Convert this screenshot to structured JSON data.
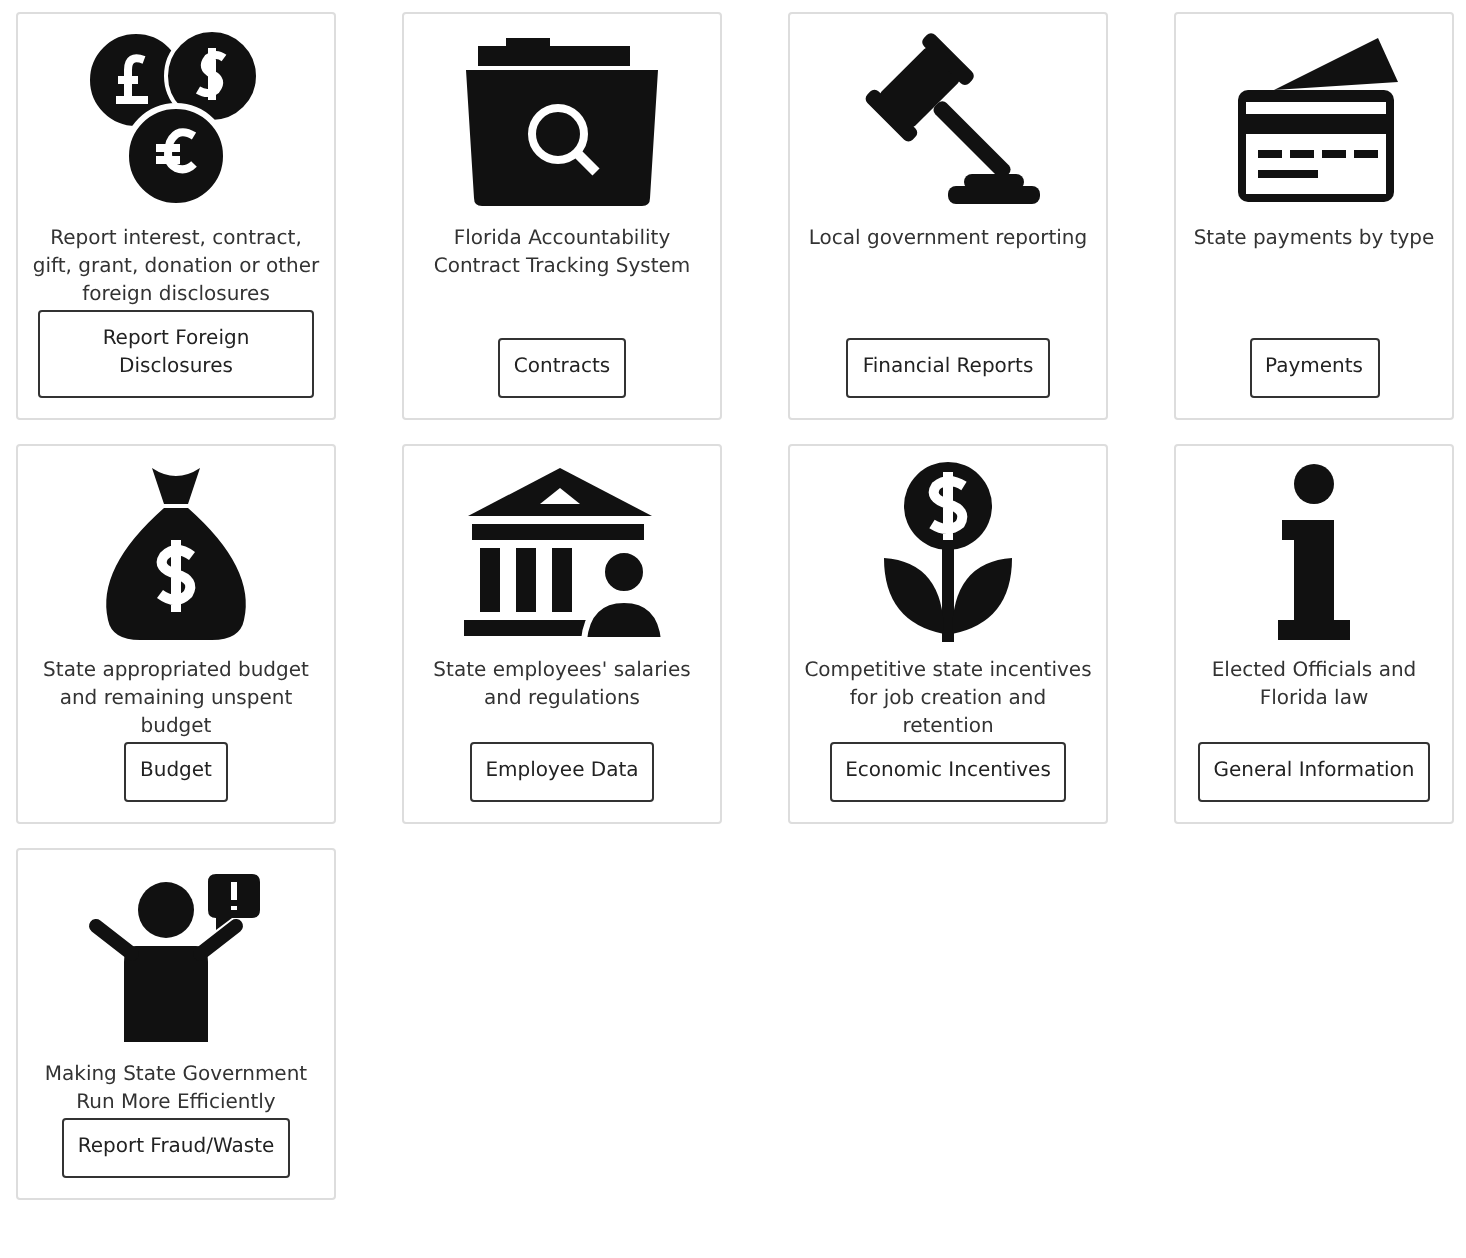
{
  "cards": [
    {
      "description": "Report interest, contract, gift, grant, donation or other foreign disclosures",
      "button": "Report Foreign Disclosures"
    },
    {
      "description": "Florida Accountability Contract Tracking System",
      "button": "Contracts"
    },
    {
      "description": "Local government reporting",
      "button": "Financial Reports"
    },
    {
      "description": "State payments by type",
      "button": "Payments"
    },
    {
      "description": "State appropriated budget and remaining unspent budget",
      "button": "Budget"
    },
    {
      "description": "State employees' salaries and regulations",
      "button": "Employee Data"
    },
    {
      "description": "Competitive state incentives for job creation and retention",
      "button": "Economic Incentives"
    },
    {
      "description": "Elected Officials and Florida law",
      "button": "General Information"
    },
    {
      "description": "Making State Government Run More Efficiently",
      "button": "Report Fraud/Waste"
    }
  ]
}
